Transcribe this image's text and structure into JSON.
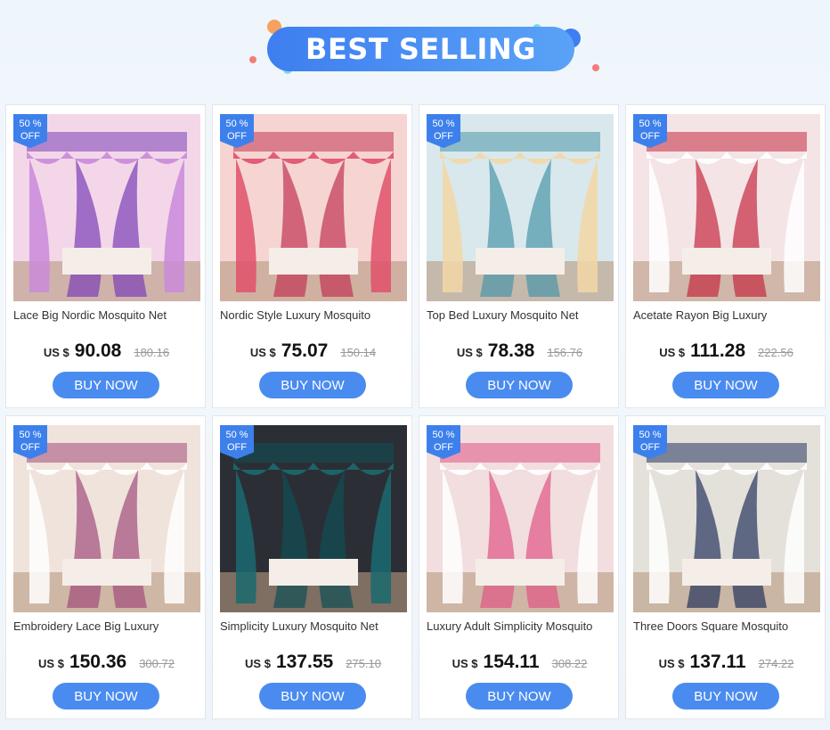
{
  "banner": {
    "title": "BEST SELLING"
  },
  "colors": {
    "accent": "#4a8bf0",
    "badge": "#3d80ec"
  },
  "buy_label": "BUY NOW",
  "products": [
    {
      "badge_pct": "50 %",
      "badge_off": "OFF",
      "title": "Lace Big Nordic Mosquito Net",
      "currency": "US $",
      "price": "90.08",
      "old_price": "180.16",
      "palette": [
        "#f3d7e9",
        "#c98ad9",
        "#7a3fb6"
      ]
    },
    {
      "badge_pct": "50 %",
      "badge_off": "OFF",
      "title": "Nordic Style Luxury Mosquito",
      "currency": "US $",
      "price": "75.07",
      "old_price": "150.14",
      "palette": [
        "#f6d4d2",
        "#e0506a",
        "#c23552"
      ]
    },
    {
      "badge_pct": "50 %",
      "badge_off": "OFF",
      "title": "Top Bed Luxury Mosquito Net",
      "currency": "US $",
      "price": "78.38",
      "old_price": "156.76",
      "palette": [
        "#d9e8ec",
        "#f2d7a6",
        "#4a95a8"
      ]
    },
    {
      "badge_pct": "50 %",
      "badge_off": "OFF",
      "title": "Acetate Rayon Big Luxury",
      "currency": "US $",
      "price": "111.28",
      "old_price": "222.56",
      "palette": [
        "#f4e4e6",
        "#ffffff",
        "#c42a40"
      ]
    },
    {
      "badge_pct": "50 %",
      "badge_off": "OFF",
      "title": "Embroidery Lace Big Luxury",
      "currency": "US $",
      "price": "150.36",
      "old_price": "300.72",
      "palette": [
        "#efe3dc",
        "#ffffff",
        "#a34c7a"
      ]
    },
    {
      "badge_pct": "50 %",
      "badge_off": "OFF",
      "title": "Simplicity Luxury Mosquito Net",
      "currency": "US $",
      "price": "137.55",
      "old_price": "275.10",
      "palette": [
        "#2b2f35",
        "#1a6a70",
        "#0f4e55"
      ]
    },
    {
      "badge_pct": "50 %",
      "badge_off": "OFF",
      "title": "Luxury Adult Simplicity Mosquito",
      "currency": "US $",
      "price": "154.11",
      "old_price": "308.22",
      "palette": [
        "#f2dedf",
        "#ffffff",
        "#e05585"
      ]
    },
    {
      "badge_pct": "50 %",
      "badge_off": "OFF",
      "title": "Three Doors Square Mosquito",
      "currency": "US $",
      "price": "137.11",
      "old_price": "274.22",
      "palette": [
        "#e4e0da",
        "#ffffff",
        "#27345c"
      ]
    }
  ]
}
